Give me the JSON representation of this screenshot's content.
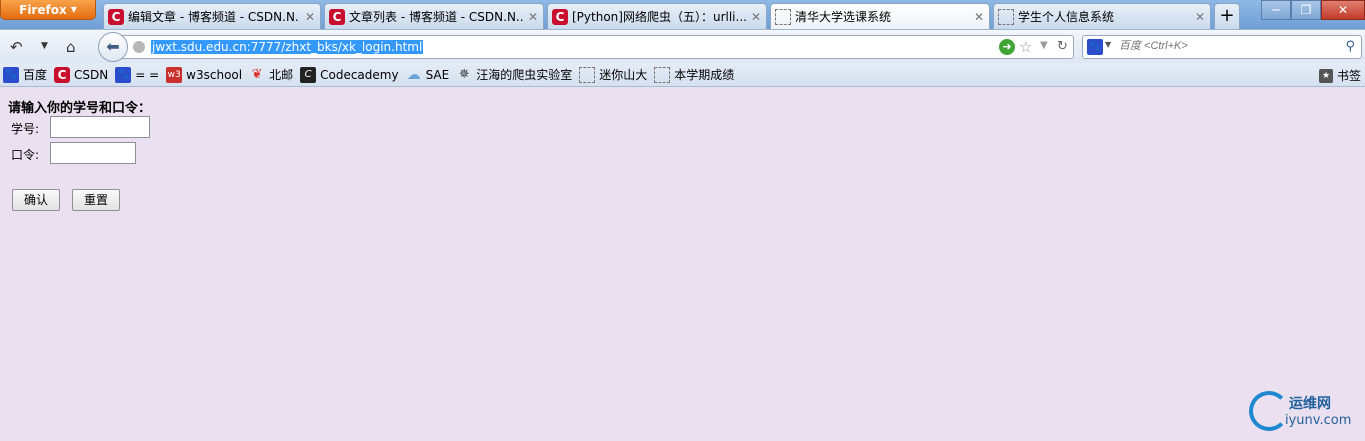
{
  "browser": {
    "menu_label": "Firefox",
    "tabs": [
      {
        "label": "编辑文章 - 博客频道 - CSDN.N...",
        "icon": "csdn-icon"
      },
      {
        "label": "文章列表 - 博客频道 - CSDN.N...",
        "icon": "csdn-icon"
      },
      {
        "label": "[Python]网络爬虫（五）：urlli...",
        "icon": "csdn-icon"
      },
      {
        "label": "清华大学选课系统",
        "icon": "blank-page-icon",
        "active": true
      },
      {
        "label": "学生个人信息系统",
        "icon": "blank-page-icon"
      }
    ],
    "new_tab": "+",
    "window_controls": {
      "minimize": "─",
      "maximize": "❐",
      "close": "✕"
    }
  },
  "navbar": {
    "url": "jwxt.sdu.edu.cn:7777/zhxt_bks/xk_login.html",
    "search_placeholder": "百度 <Ctrl+K>"
  },
  "bookmarks": {
    "items": [
      {
        "label": "百度",
        "icon": "paw-icon"
      },
      {
        "label": "CSDN",
        "icon": "csdn-icon"
      },
      {
        "label": "= =",
        "icon": "paw-icon"
      },
      {
        "label": "w3school",
        "icon": "w3school-icon"
      },
      {
        "label": "北邮",
        "icon": "bupt-icon"
      },
      {
        "label": "Codecademy",
        "icon": "codecademy-icon"
      },
      {
        "label": "SAE",
        "icon": "cloud-icon"
      },
      {
        "label": "汪海的爬虫实验室",
        "icon": "spider-icon"
      },
      {
        "label": "迷你山大",
        "icon": "blank-page-icon"
      },
      {
        "label": "本学期成绩",
        "icon": "blank-page-icon"
      }
    ],
    "right_label": "书签"
  },
  "page": {
    "prompt": "请输入你的学号和口令：",
    "student_id_label": "学号:",
    "password_label": "口令:",
    "student_id_value": "",
    "password_value": "",
    "confirm_button": "确认",
    "reset_button": "重置"
  },
  "watermark": {
    "cn": "运维网",
    "en": "iyunv.com"
  },
  "colors": {
    "page_bg": "#ebe0f0",
    "url_highlight": "#3399ff",
    "tabbar": "#7ea6d4"
  }
}
